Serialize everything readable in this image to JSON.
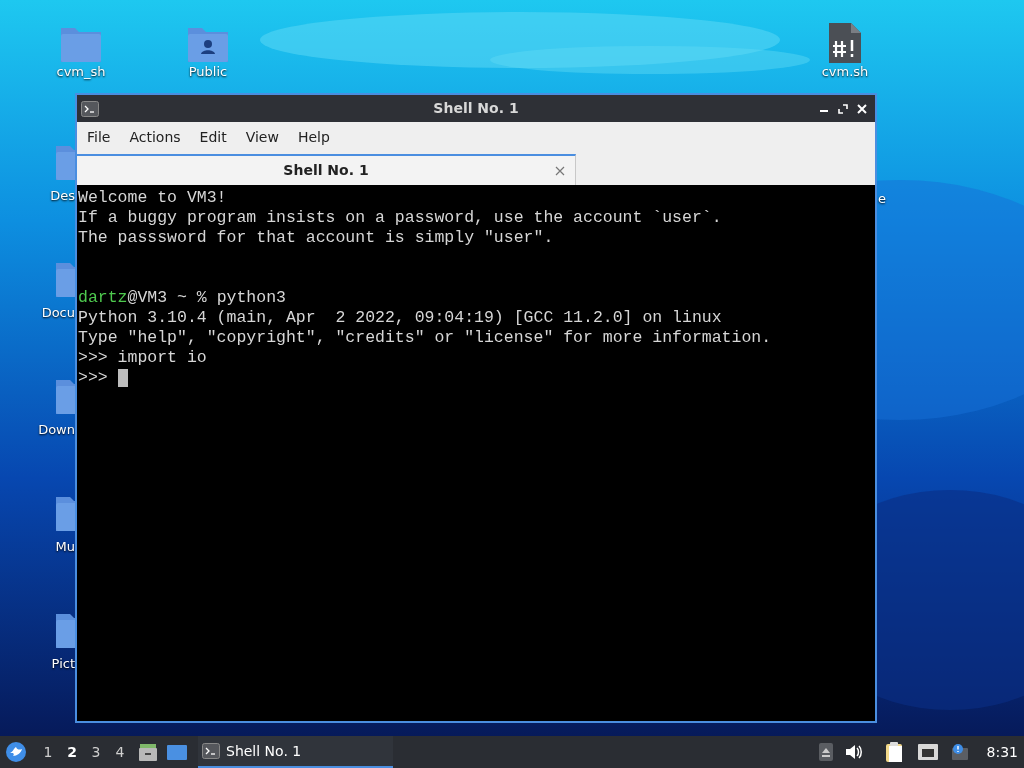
{
  "desktop": {
    "kind": "picture",
    "icons": [
      {
        "label": "cvm_sh",
        "kind": "folder"
      },
      {
        "label": "Public",
        "kind": "folder-user"
      },
      {
        "label": "cvm.sh",
        "kind": "script"
      },
      {
        "label": "Des",
        "kind": "folder-partial"
      },
      {
        "label": "Docu",
        "kind": "folder-partial"
      },
      {
        "label": "Down",
        "kind": "folder-partial"
      },
      {
        "label": "Mu",
        "kind": "folder-partial"
      },
      {
        "label": "Pict",
        "kind": "folder-partial"
      },
      {
        "label": "e",
        "kind": "label-only"
      }
    ]
  },
  "window": {
    "title": "Shell No. 1",
    "menu": [
      "File",
      "Actions",
      "Edit",
      "View",
      "Help"
    ],
    "tabs": [
      {
        "label": "Shell No. 1",
        "selected": true
      }
    ],
    "terminal": {
      "lines": [
        [
          {
            "text": "Welcome to VM3!"
          }
        ],
        [
          {
            "text": "If a buggy program insists on a password, use the account `user`."
          }
        ],
        [
          {
            "text": "The passsword for that account is simply \"user\"."
          }
        ],
        {
          "kind": "blank"
        },
        {
          "kind": "blank"
        },
        [
          {
            "text": "dartz",
            "color": "#4ec94e"
          },
          {
            "text": "@VM3 ~ % python3"
          }
        ],
        [
          {
            "text": "Python 3.10.4 (main, Apr  2 2022, 09:04:19) [GCC 11.2.0] on linux"
          }
        ],
        [
          {
            "text": "Type \"help\", \"copyright\", \"credits\" or \"license\" for more information."
          }
        ],
        [
          {
            "text": ">>> import io"
          }
        ],
        [
          {
            "text": ">>> "
          }
        ]
      ],
      "cursor": true
    }
  },
  "taskbar": {
    "workspaces": [
      {
        "label": "1",
        "selected": false
      },
      {
        "label": "2",
        "selected": true
      },
      {
        "label": "3",
        "selected": false
      },
      {
        "label": "4",
        "selected": false
      }
    ],
    "tasks": [
      {
        "label": "Shell No. 1",
        "selected": true
      }
    ],
    "clock": "8:31"
  }
}
